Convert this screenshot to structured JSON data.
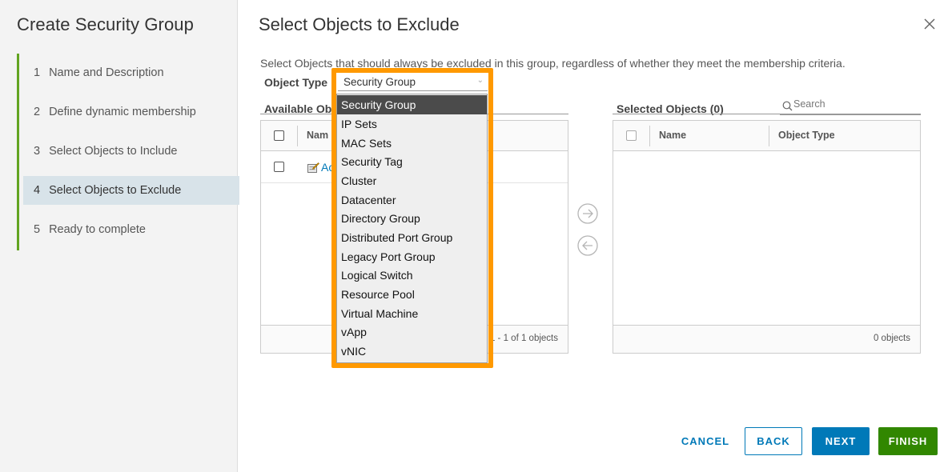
{
  "wizard": {
    "title": "Create Security Group",
    "steps": [
      {
        "num": "1",
        "label": "Name and Description"
      },
      {
        "num": "2",
        "label": "Define dynamic membership"
      },
      {
        "num": "3",
        "label": "Select Objects to Include"
      },
      {
        "num": "4",
        "label": "Select Objects to Exclude"
      },
      {
        "num": "5",
        "label": "Ready to complete"
      }
    ],
    "active_step": 4
  },
  "page": {
    "title": "Select Objects to Exclude",
    "description": "Select Objects that should always be excluded in this group, regardless of whether they meet the membership criteria."
  },
  "object_type": {
    "label": "Object Type",
    "selected": "Security Group",
    "options": [
      "Security Group",
      "IP Sets",
      "MAC Sets",
      "Security Tag",
      "Cluster",
      "Datacenter",
      "Directory Group",
      "Distributed Port Group",
      "Legacy Port Group",
      "Logical Switch",
      "Resource Pool",
      "Virtual Machine",
      "vApp",
      "vNIC"
    ]
  },
  "available": {
    "label": "Available Ob",
    "col_name": "Nam",
    "row_link": "Ac",
    "footer": "1 - 1 of 1 objects"
  },
  "selected": {
    "label": "Selected Objects (0)",
    "search_placeholder": "Search",
    "col_name": "Name",
    "col_type": "Object Type",
    "footer": "0 objects"
  },
  "buttons": {
    "cancel": "CANCEL",
    "back": "BACK",
    "next": "NEXT",
    "finish": "FINISH"
  },
  "colors": {
    "accent": "#0079b8",
    "finish": "#318700",
    "progress": "#62a420",
    "highlight": "#ff9900"
  }
}
